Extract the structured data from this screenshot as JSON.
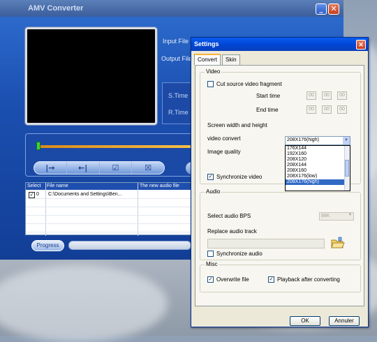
{
  "amv": {
    "title": "AMV Converter",
    "min_glyph": "_",
    "close_glyph": "✕",
    "input_file_label": "Input File",
    "output_file_label": "Output File",
    "s_time_label": "S.Time",
    "r_time_label": "R.Time",
    "controls": [
      "|→",
      "←|",
      "☑",
      "☒"
    ],
    "table": {
      "headers": [
        "Select",
        "File name",
        "The new audio file"
      ],
      "rows": [
        {
          "checked": "✓",
          "index": "0",
          "path": "C:\\Documents and Settings\\Ben..."
        }
      ]
    },
    "progress_label": "Progress"
  },
  "settings": {
    "title": "Settings",
    "close_glyph": "✕",
    "tabs": [
      "Convert",
      "Skin"
    ],
    "video": {
      "legend": "Video",
      "cut_label": "Cut source video fragment",
      "start_time_label": "Start time",
      "end_time_label": "End time",
      "start_values": [
        "00",
        "00",
        "00"
      ],
      "end_values": [
        "00",
        "00",
        "00"
      ],
      "screen_label": "Screen width and height",
      "screen_selected": "208X176(high)",
      "screen_options": [
        "176X144",
        "192X160",
        "208X120",
        "208X144",
        "208X160",
        "208X176(low)",
        "208X176(high)"
      ],
      "video_convert_label": "video convert",
      "image_quality_label": "Image quality",
      "sync_checked": "✓",
      "sync_label": "Synchronize video"
    },
    "audio": {
      "legend": "Audio",
      "bps_label": "Select audio BPS",
      "bps_value": "88K",
      "replace_label": "Replace audio track",
      "sync_label": "Synchronize audio"
    },
    "misc": {
      "legend": "Misc",
      "overwrite_checked": "✓",
      "overwrite_label": "Overwrite file",
      "playback_checked": "✓",
      "playback_label": "Playback after converting"
    },
    "ok_label": "OK",
    "cancel_label": "Annuler"
  }
}
